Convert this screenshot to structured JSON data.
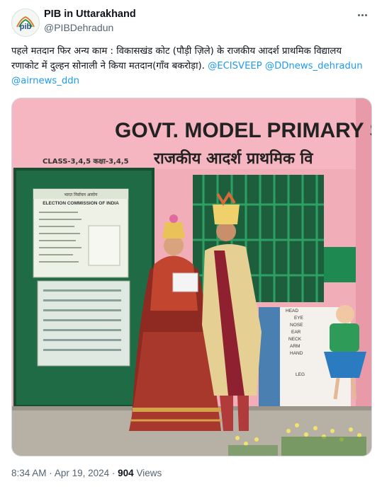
{
  "author": {
    "name": "PIB in Uttarakhand",
    "handle": "@PIBDehradun",
    "avatar_text": "pib"
  },
  "tweet": {
    "text": "पहले मतदान फिर अन्य काम : विकासखंड कोट (पौड़ी ज़िले) के राजकीय आदर्श प्राथमिक विद्यालय रणाकोट में दुल्हन सोनाली ने किया मतदान(गाँव बकरोड़ा).",
    "mentions": [
      "@ECISVEEP",
      "@DDnews_dehradun",
      "@airnews_ddn"
    ]
  },
  "media": {
    "sign_english": "GOVT. MODEL PRIMARY SCH",
    "sign_hindi": "राजकीय आदर्श प्राथमिक वि",
    "class_text": "CLASS-3,4,5 कक्षा-3,4,5",
    "poster_title": "ELECTION COMMISSION OF INDIA",
    "poster_title_hindi": "भारत निर्वाचन आयोग",
    "mural_labels": [
      "HEAD",
      "EYE",
      "NOSE",
      "EAR",
      "NECK",
      "ARM",
      "HAND",
      "LEG"
    ]
  },
  "footer": {
    "time": "8:34 AM",
    "separator": "·",
    "date": "Apr 19, 2024",
    "views_count": "904",
    "views_label": "Views"
  },
  "colors": {
    "link": "#1d9bf0",
    "secondary_text": "#536471",
    "wall_pink": "#f2aeb8",
    "wall_green": "#1e8a52",
    "door_green": "#1f6b45"
  }
}
